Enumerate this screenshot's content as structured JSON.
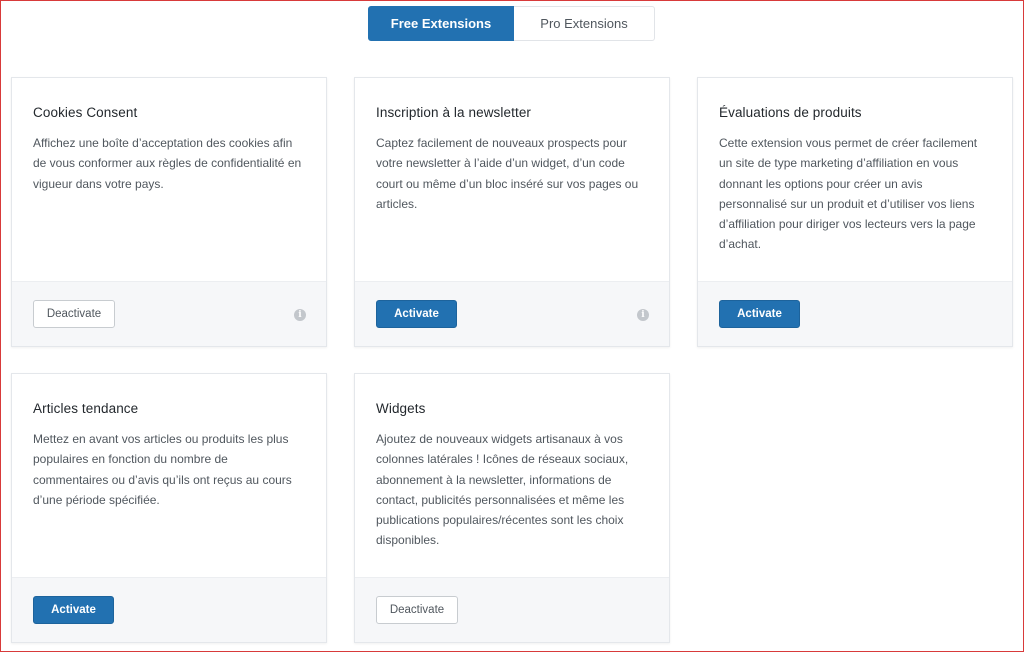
{
  "tabs": [
    {
      "label": "Free Extensions",
      "active": true
    },
    {
      "label": "Pro Extensions",
      "active": false
    }
  ],
  "cards": [
    {
      "title": "Cookies Consent",
      "description": "Affichez une boîte d’acceptation des cookies afin de vous conformer aux règles de confidentialité en vigueur dans votre pays.",
      "button": "Deactivate",
      "info_icon": "info-icon"
    },
    {
      "title": "Inscription à la newsletter",
      "description": "Captez facilement de nouveaux prospects pour votre newsletter à l’aide d’un widget, d’un code court ou même d’un bloc inséré sur vos pages ou articles.",
      "button": "Activate",
      "info_icon": "info-icon"
    },
    {
      "title": "Évaluations de produits",
      "description": "Cette extension vous permet de créer facilement un site de type marketing d’affiliation en vous donnant les options pour créer un avis personnalisé sur un produit et d’utiliser vos liens d’affiliation pour diriger vos lecteurs vers la page d’achat.",
      "button": "Activate"
    },
    {
      "title": "Articles tendance",
      "description": "Mettez en avant vos articles ou produits les plus populaires en fonction du nombre de commentaires ou d’avis qu’ils ont reçus au cours d’une période spécifiée.",
      "button": "Activate"
    },
    {
      "title": "Widgets",
      "description": "Ajoutez de nouveaux widgets artisanaux à vos colonnes latérales ! Icônes de réseaux sociaux, abonnement à la newsletter, informations de contact, publicités personnalisées et même les publications populaires/récentes sont les choix disponibles.",
      "button": "Deactivate"
    }
  ],
  "colors": {
    "accent": "#2271b1",
    "footer_bg": "#f6f7f9",
    "frame_border": "#d83a3a"
  }
}
